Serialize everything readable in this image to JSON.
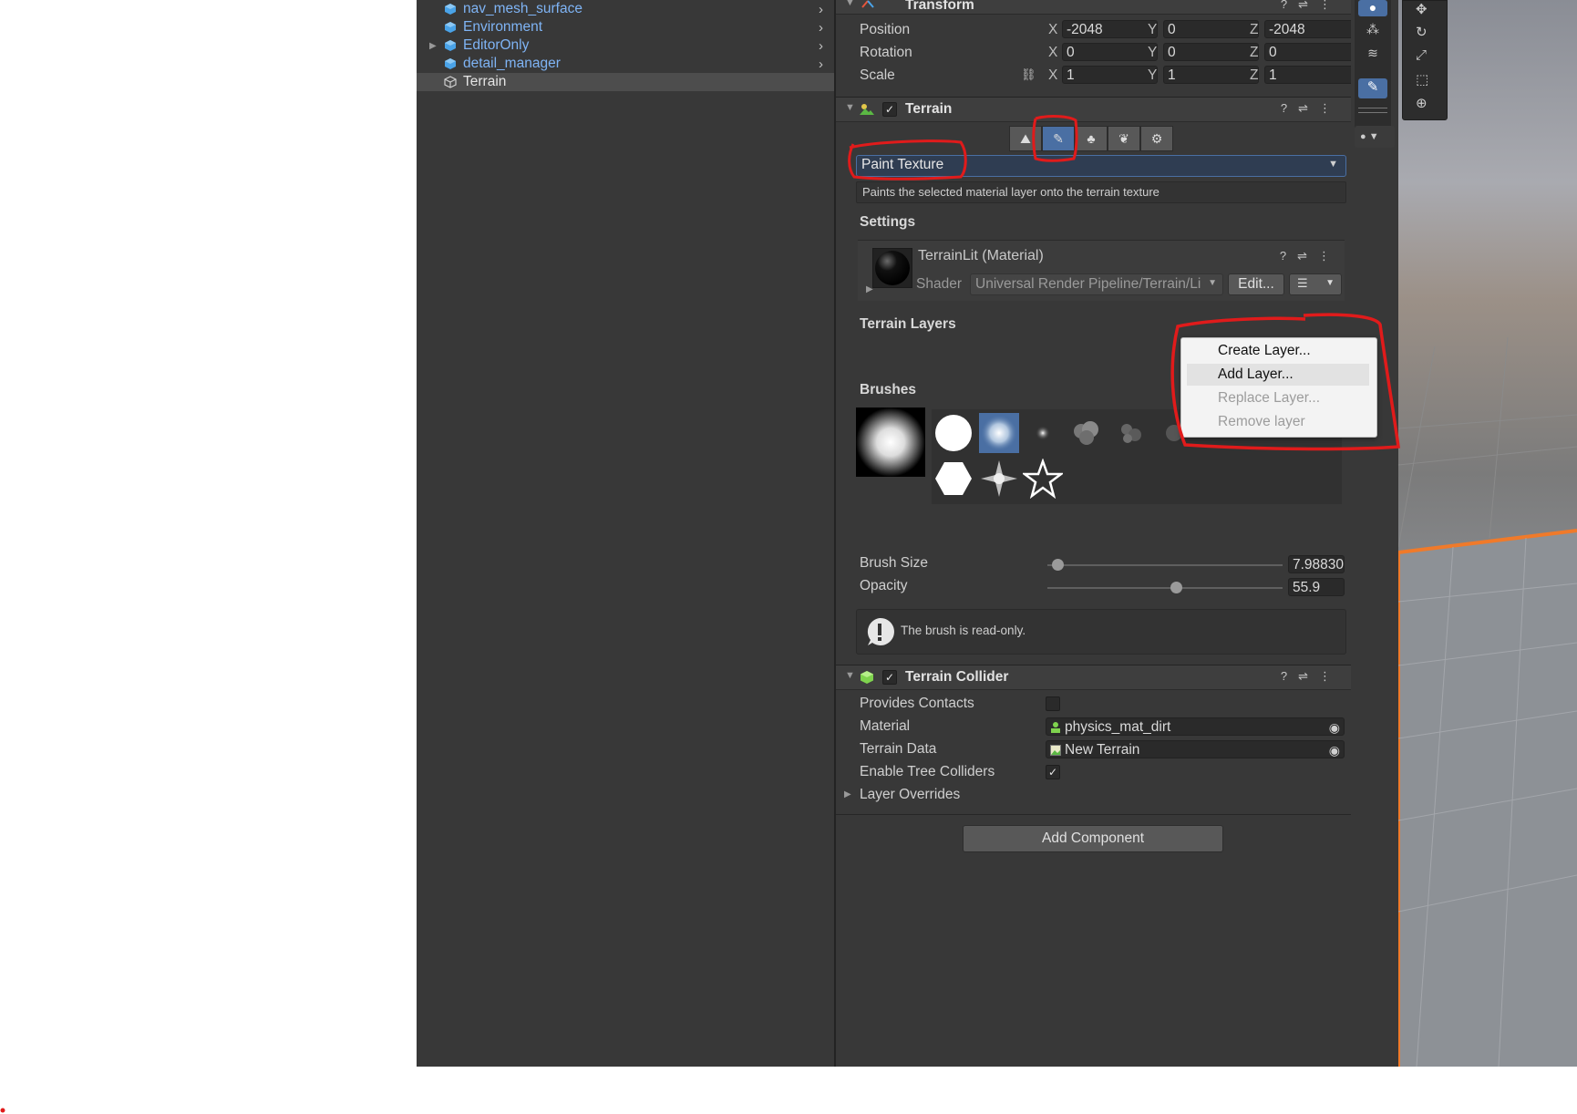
{
  "hierarchy": {
    "items": [
      {
        "label": "nav_mesh_surface",
        "has_children": true
      },
      {
        "label": "Environment",
        "has_children": true
      },
      {
        "label": "EditorOnly",
        "has_children": true
      },
      {
        "label": "detail_manager",
        "has_children": true
      },
      {
        "label": "Terrain",
        "selected": true
      }
    ]
  },
  "transform": {
    "title": "Transform",
    "rows": [
      {
        "label": "Position",
        "x": "-2048",
        "y": "0",
        "z": "-2048"
      },
      {
        "label": "Rotation",
        "x": "0",
        "y": "0",
        "z": "0"
      },
      {
        "label": "Scale",
        "x": "1",
        "y": "1",
        "z": "1"
      }
    ],
    "axis": {
      "x": "X",
      "y": "Y",
      "z": "Z"
    }
  },
  "terrain": {
    "title": "Terrain",
    "tool_dropdown": "Paint Texture",
    "tool_description": "Paints the selected material layer onto the terrain texture",
    "settings_title": "Settings",
    "material_name": "TerrainLit (Material)",
    "shader_label": "Shader",
    "shader_value": "Universal Render Pipeline/Terrain/Li",
    "edit_button": "Edit...",
    "terrain_layers_title": "Terrain Layers",
    "brushes_title": "Brushes",
    "brush_size_label": "Brush Size",
    "brush_size_value": "7.98830",
    "brush_size_fraction": 0.02,
    "opacity_label": "Opacity",
    "opacity_value": "55.9",
    "opacity_fraction": 0.55,
    "readonly_note": "The brush is read-only."
  },
  "terrain_collider": {
    "title": "Terrain Collider",
    "provides_contacts_label": "Provides Contacts",
    "material_label": "Material",
    "material_value": "physics_mat_dirt",
    "terrain_data_label": "Terrain Data",
    "terrain_data_value": "New Terrain",
    "enable_tree_colliders_label": "Enable Tree Colliders",
    "layer_overrides_label": "Layer Overrides"
  },
  "add_component_button": "Add Component",
  "context_menu": {
    "items": [
      {
        "label": "Create Layer...",
        "enabled": true
      },
      {
        "label": "Add Layer...",
        "enabled": true,
        "hover": true
      },
      {
        "label": "Replace Layer...",
        "enabled": false
      },
      {
        "label": "Remove layer",
        "enabled": false
      }
    ]
  },
  "colors": {
    "panel_bg": "#383838",
    "hierarchy_link": "#7fb4f5",
    "active_tool": "#4a6fa3",
    "annotation_red": "#e01b1b",
    "scene_orange": "#f07a2a"
  }
}
